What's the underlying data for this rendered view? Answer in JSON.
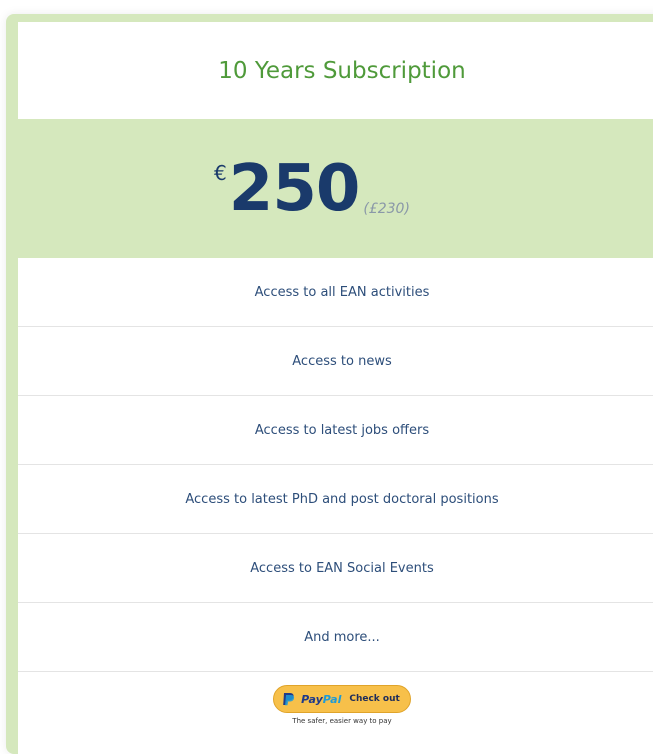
{
  "plan": {
    "title": "10 Years Subscription",
    "currency_symbol": "€",
    "amount": "250",
    "alt_price": "(£230)"
  },
  "features": [
    "Access to all EAN activities",
    "Access to news",
    "Access to latest jobs offers",
    "Access to latest PhD and post doctoral positions",
    "Access to EAN Social Events",
    "And more..."
  ],
  "paypal": {
    "brand_pay": "Pay",
    "brand_pal": "Pal",
    "checkout_label": "Check out",
    "tagline": "The safer, easier way to pay",
    "icon": "paypal-icon"
  },
  "colors": {
    "accent_green": "#d5e8bd",
    "title_green": "#4f9a3a",
    "price_navy": "#1a3a6b",
    "feature_text": "#2d4e7a",
    "paypal_yellow": "#f7c04a"
  }
}
